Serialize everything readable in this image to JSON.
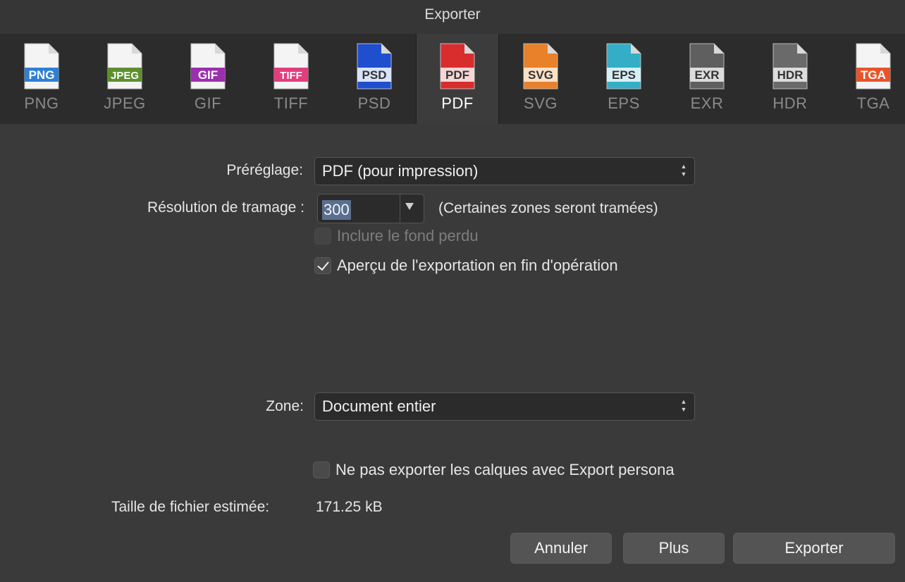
{
  "window": {
    "title": "Exporter"
  },
  "formats": [
    {
      "name": "PNG",
      "badge": "PNG",
      "color": "#2f7fd6",
      "active": false
    },
    {
      "name": "JPEG",
      "badge": "JPEG",
      "color": "#5e8f2e",
      "active": false
    },
    {
      "name": "GIF",
      "badge": "GIF",
      "color": "#9b2fae",
      "active": false
    },
    {
      "name": "TIFF",
      "badge": "TIFF",
      "color": "#e23d7c",
      "active": false
    },
    {
      "name": "PSD",
      "badge": "PSD",
      "color": "#1f4fcf",
      "active": false
    },
    {
      "name": "PDF",
      "badge": "PDF",
      "color": "#d92d2d",
      "active": true
    },
    {
      "name": "SVG",
      "badge": "SVG",
      "color": "#e8812a",
      "active": false
    },
    {
      "name": "EPS",
      "badge": "EPS",
      "color": "#33aec6",
      "active": false
    },
    {
      "name": "EXR",
      "badge": "EXR",
      "color": "#5f5f5f",
      "active": false
    },
    {
      "name": "HDR",
      "badge": "HDR",
      "color": "#6a6a6a",
      "active": false
    },
    {
      "name": "TGA",
      "badge": "TGA",
      "color": "#e8542a",
      "active": false
    }
  ],
  "preset": {
    "label": "Préréglage:",
    "value": "PDF (pour impression)"
  },
  "raster": {
    "label": "Résolution de tramage :",
    "value": "300",
    "note": "(Certaines zones seront tramées)"
  },
  "options": {
    "bleed": {
      "label": "Inclure le fond perdu",
      "checked": false,
      "enabled": false
    },
    "preview": {
      "label": "Aperçu de l'exportation en fin d'opération",
      "checked": true,
      "enabled": true
    }
  },
  "area": {
    "label": "Zone:",
    "value": "Document entier"
  },
  "persona": {
    "label": "Ne pas exporter les calques avec Export persona",
    "checked": false
  },
  "filesize": {
    "label": "Taille de fichier estimée:",
    "value": "171.25 kB"
  },
  "buttons": {
    "cancel": "Annuler",
    "more": "Plus",
    "export": "Exporter"
  }
}
